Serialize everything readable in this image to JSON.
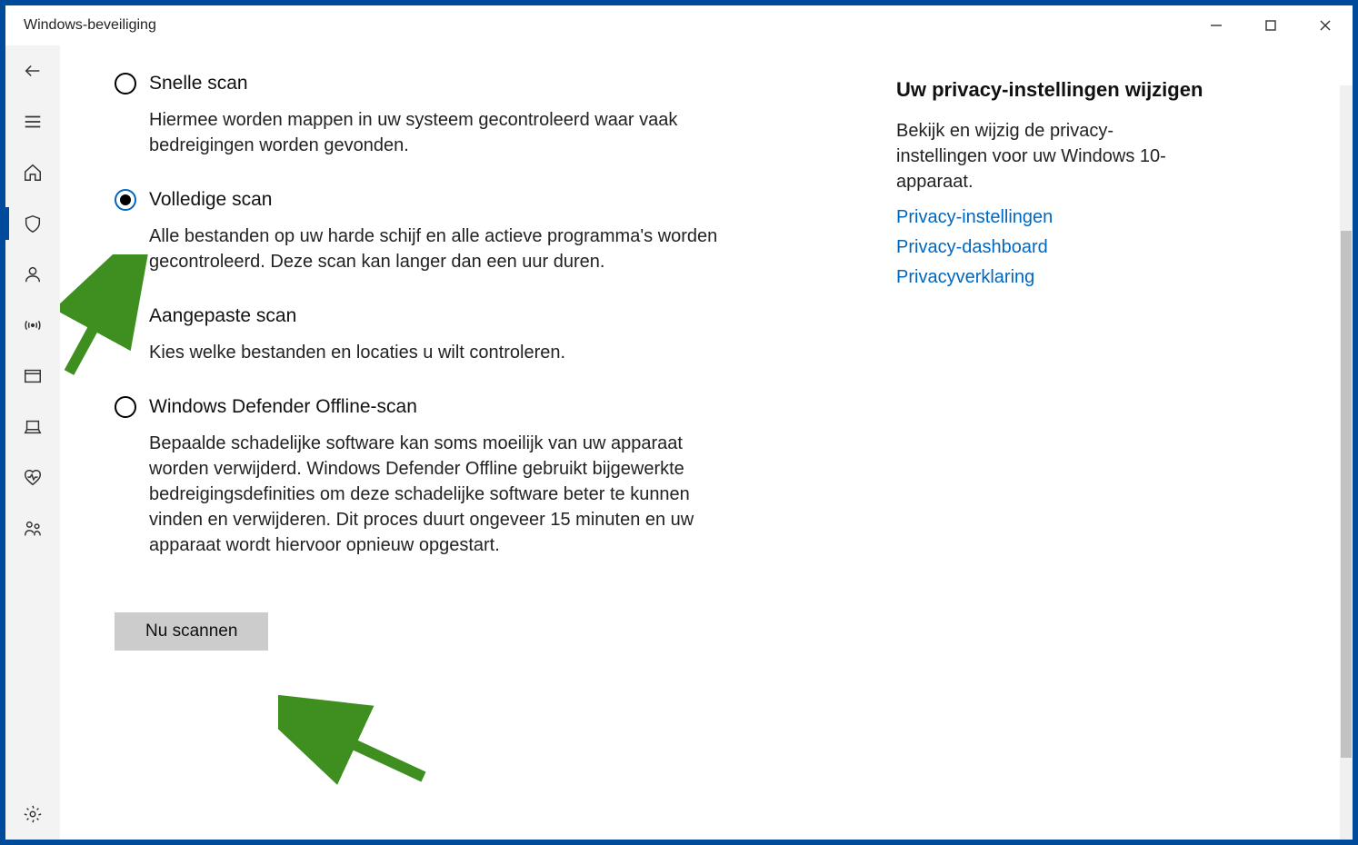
{
  "window": {
    "title": "Windows-beveiliging"
  },
  "scans": [
    {
      "id": "quick",
      "label": "Snelle scan",
      "description": "Hiermee worden mappen in uw systeem gecontroleerd waar vaak bedreigingen worden gevonden.",
      "selected": false
    },
    {
      "id": "full",
      "label": "Volledige scan",
      "description": "Alle bestanden op uw harde schijf en alle actieve programma's worden gecontroleerd. Deze scan kan langer dan een uur duren.",
      "selected": true
    },
    {
      "id": "custom",
      "label": "Aangepaste scan",
      "description": "Kies welke bestanden en locaties u wilt controleren.",
      "selected": false
    },
    {
      "id": "offline",
      "label": "Windows Defender Offline-scan",
      "description": "Bepaalde schadelijke software kan soms moeilijk van uw apparaat worden verwijderd. Windows Defender Offline gebruikt bijgewerkte bedreigingsdefinities om deze schadelijke software beter te kunnen vinden en verwijderen. Dit proces duurt ongeveer 15 minuten en uw apparaat wordt hiervoor opnieuw opgestart.",
      "selected": false
    }
  ],
  "scan_now_label": "Nu scannen",
  "privacy": {
    "heading": "Uw privacy-instellingen wijzigen",
    "description": "Bekijk en wijzig de privacy-instellingen voor uw Windows 10-apparaat.",
    "links": [
      "Privacy-instellingen",
      "Privacy-dashboard",
      "Privacyverklaring"
    ]
  }
}
